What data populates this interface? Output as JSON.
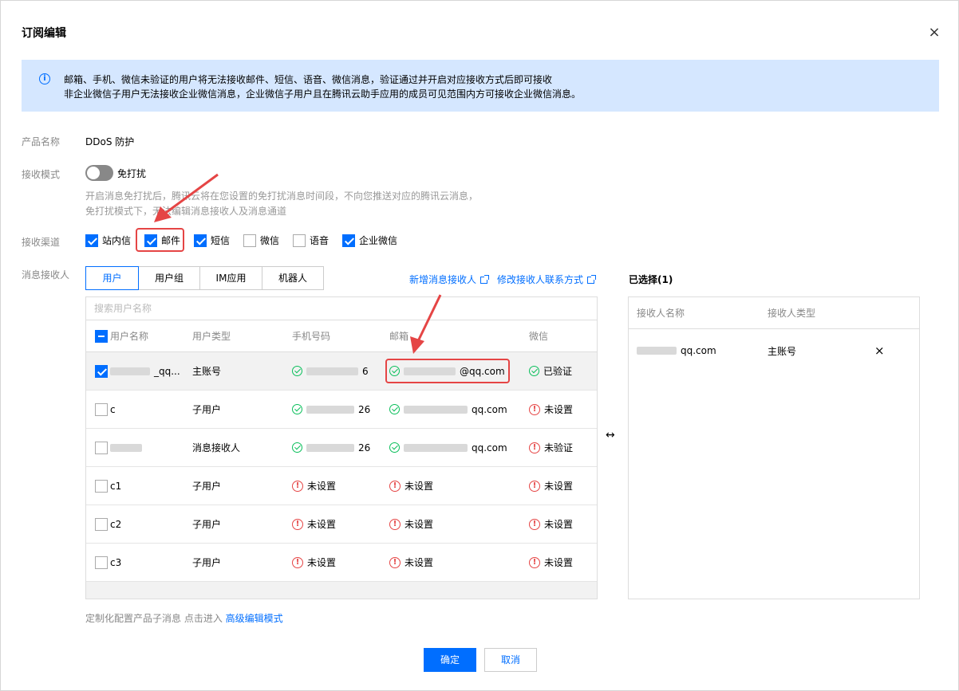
{
  "dialog": {
    "title": "订阅编辑",
    "close_glyph": "×"
  },
  "notice": {
    "line1": "邮箱、手机、微信未验证的用户将无法接收邮件、短信、语音、微信消息，验证通过并开启对应接收方式后即可接收",
    "line2": "非企业微信子用户无法接收企业微信消息，企业微信子用户且在腾讯云助手应用的成员可见范围内方可接收企业微信消息。"
  },
  "form": {
    "product_label": "产品名称",
    "product_value": "DDoS 防护",
    "mode_label": "接收模式",
    "mode_switch_label": "免打扰",
    "mode_switch_on": false,
    "mode_hint1": "开启消息免打扰后，腾讯云将在您设置的免打扰消息时间段，不向您推送对应的腾讯云消息，",
    "mode_hint2": "免打扰模式下，无法编辑消息接收人及消息通道",
    "channel_label": "接收渠道",
    "channels": [
      {
        "label": "站内信",
        "checked": true
      },
      {
        "label": "邮件",
        "checked": true
      },
      {
        "label": "短信",
        "checked": true
      },
      {
        "label": "微信",
        "checked": false
      },
      {
        "label": "语音",
        "checked": false
      },
      {
        "label": "企业微信",
        "checked": true
      }
    ],
    "recipient_label": "消息接收人"
  },
  "tabs": [
    "用户",
    "用户组",
    "IM应用",
    "机器人"
  ],
  "links": {
    "add_recipient": "新增消息接收人",
    "edit_contact": "修改接收人联系方式"
  },
  "user_table": {
    "search_placeholder": "搜索用户名称",
    "headers": [
      "用户名称",
      "用户类型",
      "手机号码",
      "邮箱",
      "微信"
    ],
    "rows": [
      {
        "name": "_qq...",
        "type": "主账号",
        "phone": "6",
        "phone_ok": true,
        "email": "@qq.com",
        "email_ok": true,
        "wechat": "已验证",
        "wechat_ok": true,
        "checked": true
      },
      {
        "name": "c",
        "type": "子用户",
        "phone": "26",
        "phone_ok": true,
        "email": "qq.com",
        "email_ok": true,
        "wechat": "未设置",
        "wechat_ok": false,
        "checked": false
      },
      {
        "name": "",
        "type": "消息接收人",
        "phone": "26",
        "phone_ok": true,
        "email": "qq.com",
        "email_ok": true,
        "wechat": "未验证",
        "wechat_ok": false,
        "checked": false
      },
      {
        "name": "c1",
        "type": "子用户",
        "phone": "未设置",
        "phone_ok": false,
        "email": "未设置",
        "email_ok": false,
        "wechat": "未设置",
        "wechat_ok": false,
        "checked": false
      },
      {
        "name": "c2",
        "type": "子用户",
        "phone": "未设置",
        "phone_ok": false,
        "email": "未设置",
        "email_ok": false,
        "wechat": "未设置",
        "wechat_ok": false,
        "checked": false
      },
      {
        "name": "c3",
        "type": "子用户",
        "phone": "未设置",
        "phone_ok": false,
        "email": "未设置",
        "email_ok": false,
        "wechat": "未设置",
        "wechat_ok": false,
        "checked": false
      }
    ]
  },
  "selected": {
    "title": "已选择(1)",
    "headers": [
      "接收人名称",
      "接收人类型"
    ],
    "rows": [
      {
        "name": "qq.com",
        "type": "主账号",
        "remove_glyph": "×"
      }
    ]
  },
  "swap_glyph": "↔",
  "footer": {
    "note": "定制化配置产品子消息 点击进入",
    "link": "高级编辑模式"
  },
  "buttons": {
    "confirm": "确定",
    "cancel": "取消"
  },
  "colors": {
    "accent": "#006eff",
    "notice_bg": "#d5e7ff",
    "success": "#0abf5b",
    "warning": "#e54545",
    "annotation": "#e54545"
  }
}
